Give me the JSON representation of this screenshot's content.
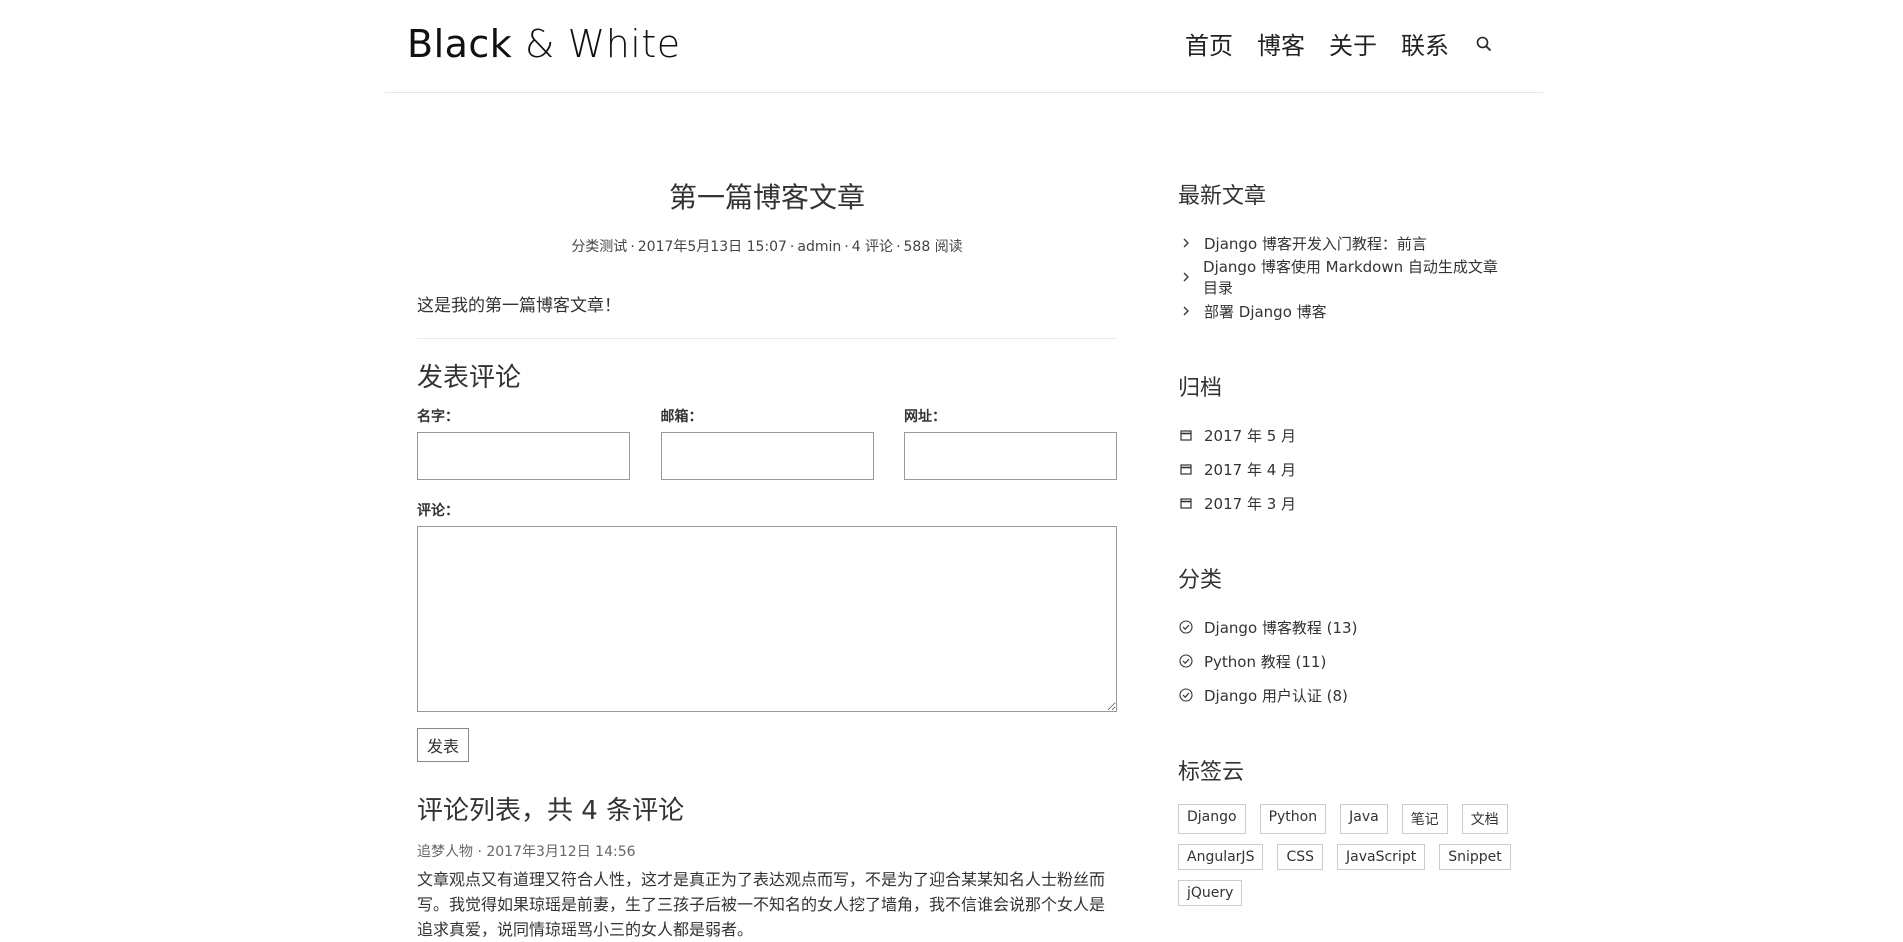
{
  "header": {
    "logo_black": "Black",
    "logo_amp": "&",
    "logo_white": "White",
    "nav": [
      "首页",
      "博客",
      "关于",
      "联系"
    ]
  },
  "post": {
    "title": "第一篇博客文章",
    "category": "分类测试",
    "date": "2017年5月13日 15:07",
    "author": "admin",
    "comments": "4 评论",
    "views": "588 阅读",
    "content": "这是我的第一篇博客文章！"
  },
  "form": {
    "heading": "发表评论",
    "name_label": "名字：",
    "email_label": "邮箱：",
    "url_label": "网址：",
    "comment_label": "评论：",
    "submit_label": "发表"
  },
  "comment_list": {
    "heading": "评论列表，共 4 条评论",
    "items": [
      {
        "author": "追梦人物",
        "date": "2017年3月12日 14:56",
        "text": "文章观点又有道理又符合人性，这才是真正为了表达观点而写，不是为了迎合某某知名人士粉丝而写。我觉得如果琼瑶是前妻，生了三孩子后被一不知名的女人挖了墙角，我不信谁会说那个女人是追求真爱，说同情琼瑶骂小三的女人都是弱者。"
      }
    ]
  },
  "sidebar": {
    "recent_heading": "最新文章",
    "recent": [
      "Django 博客开发入门教程：前言",
      "Django 博客使用 Markdown 自动生成文章目录",
      "部署 Django 博客"
    ],
    "archive_heading": "归档",
    "archives": [
      "2017 年 5 月",
      "2017 年 4 月",
      "2017 年 3 月"
    ],
    "category_heading": "分类",
    "categories": [
      "Django 博客教程 (13)",
      "Python 教程 (11)",
      "Django 用户认证 (8)"
    ],
    "tags_heading": "标签云",
    "tags": [
      "Django",
      "Python",
      "Java",
      "笔记",
      "文档",
      "AngularJS",
      "CSS",
      "JavaScript",
      "Snippet",
      "jQuery"
    ]
  }
}
